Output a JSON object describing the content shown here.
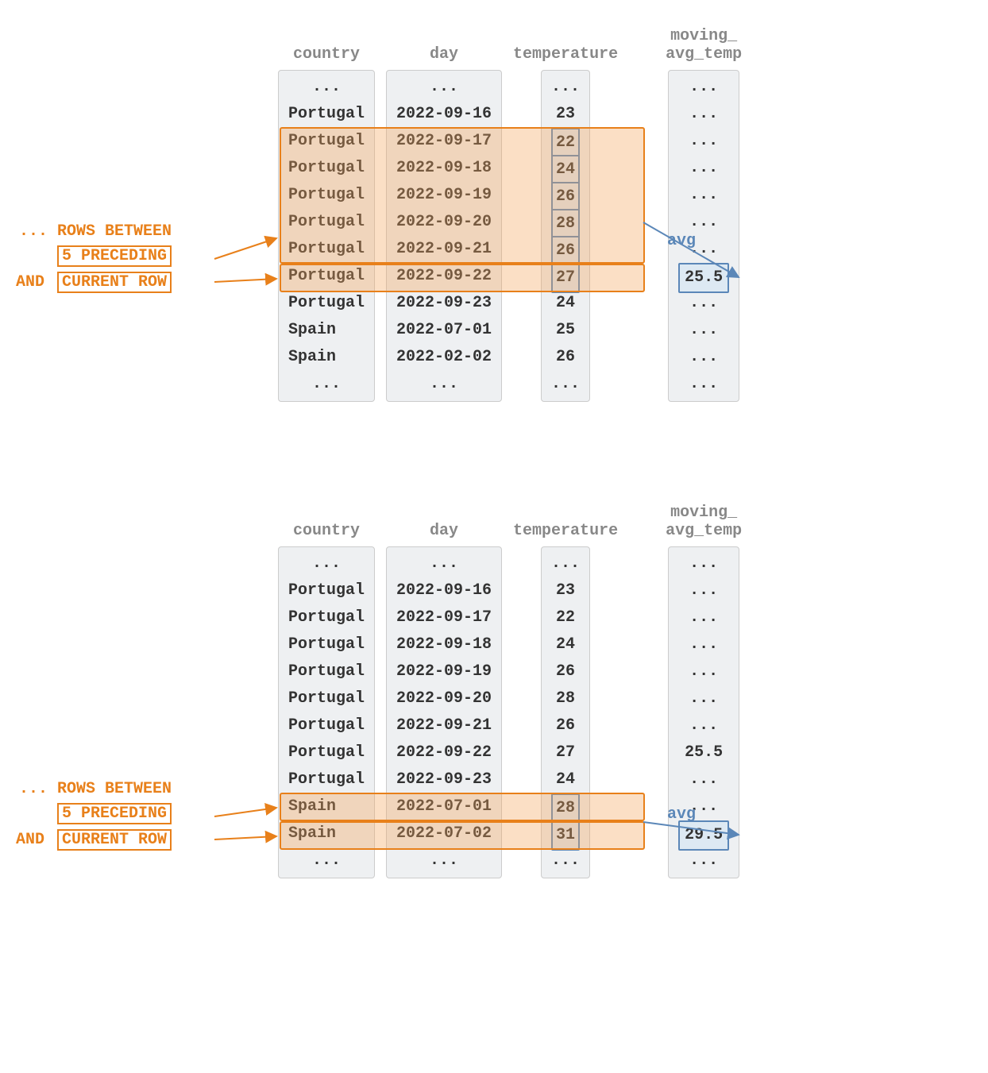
{
  "labels": {
    "rows_between": "... ROWS BETWEEN",
    "preceding": "5 PRECEDING",
    "and": "AND",
    "current_row": "CURRENT ROW",
    "avg": "avg"
  },
  "headers": {
    "country": "country",
    "day": "day",
    "temperature": "temperature",
    "moving": "moving_\navg_temp"
  },
  "d1": {
    "rows": [
      {
        "country": "...",
        "day": "...",
        "temp": "...",
        "res": "..."
      },
      {
        "country": "Portugal",
        "day": "2022-09-16",
        "temp": "23",
        "res": "..."
      },
      {
        "country": "Portugal",
        "day": "2022-09-17",
        "temp": "22",
        "res": "...",
        "tempBox": true
      },
      {
        "country": "Portugal",
        "day": "2022-09-18",
        "temp": "24",
        "res": "...",
        "tempBox": true
      },
      {
        "country": "Portugal",
        "day": "2022-09-19",
        "temp": "26",
        "res": "...",
        "tempBox": true
      },
      {
        "country": "Portugal",
        "day": "2022-09-20",
        "temp": "28",
        "res": "...",
        "tempBox": true
      },
      {
        "country": "Portugal",
        "day": "2022-09-21",
        "temp": "26",
        "res": "...",
        "tempBox": true
      },
      {
        "country": "Portugal",
        "day": "2022-09-22",
        "temp": "27",
        "res": "25.5",
        "resBox": true,
        "tempBox": true
      },
      {
        "country": "Portugal",
        "day": "2022-09-23",
        "temp": "24",
        "res": "..."
      },
      {
        "country": "Spain",
        "day": "2022-07-01",
        "temp": "25",
        "res": "..."
      },
      {
        "country": "Spain",
        "day": "2022-02-02",
        "temp": "26",
        "res": "..."
      },
      {
        "country": "...",
        "day": "...",
        "temp": "...",
        "res": "..."
      }
    ]
  },
  "d2": {
    "rows": [
      {
        "country": "...",
        "day": "...",
        "temp": "...",
        "res": "..."
      },
      {
        "country": "Portugal",
        "day": "2022-09-16",
        "temp": "23",
        "res": "..."
      },
      {
        "country": "Portugal",
        "day": "2022-09-17",
        "temp": "22",
        "res": "..."
      },
      {
        "country": "Portugal",
        "day": "2022-09-18",
        "temp": "24",
        "res": "..."
      },
      {
        "country": "Portugal",
        "day": "2022-09-19",
        "temp": "26",
        "res": "..."
      },
      {
        "country": "Portugal",
        "day": "2022-09-20",
        "temp": "28",
        "res": "..."
      },
      {
        "country": "Portugal",
        "day": "2022-09-21",
        "temp": "26",
        "res": "..."
      },
      {
        "country": "Portugal",
        "day": "2022-09-22",
        "temp": "27",
        "res": "25.5"
      },
      {
        "country": "Portugal",
        "day": "2022-09-23",
        "temp": "24",
        "res": "..."
      },
      {
        "country": "Spain",
        "day": "2022-07-01",
        "temp": "28",
        "res": "...",
        "tempBox": true
      },
      {
        "country": "Spain",
        "day": "2022-07-02",
        "temp": "31",
        "res": "29.5",
        "resBox": true,
        "tempBox": true
      },
      {
        "country": "...",
        "day": "...",
        "temp": "...",
        "res": "..."
      }
    ]
  }
}
